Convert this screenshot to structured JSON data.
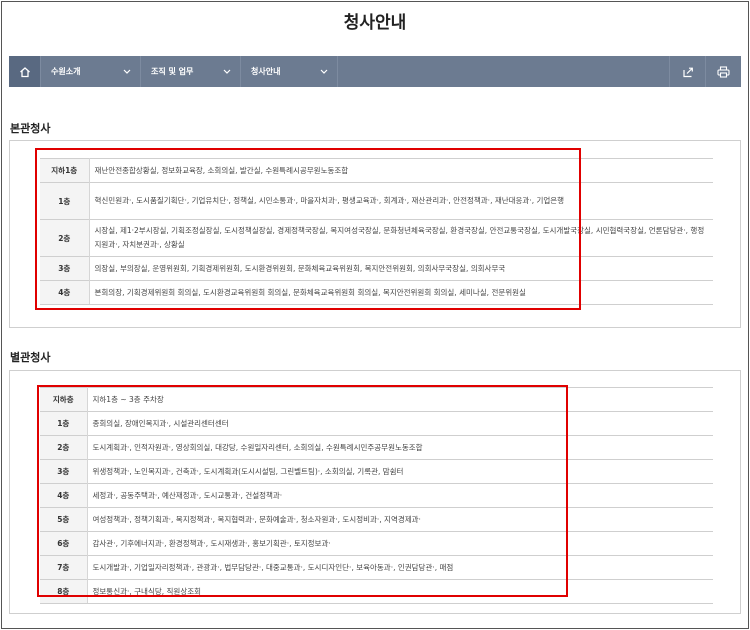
{
  "page": {
    "title": "청사안내"
  },
  "nav": {
    "items": [
      {
        "label": "수원소개"
      },
      {
        "label": "조직 및 업무"
      },
      {
        "label": "청사안내"
      }
    ],
    "home_icon": "home-icon",
    "share_icon": "share-icon",
    "print_icon": "print-icon"
  },
  "main_building": {
    "title": "본관청사",
    "rows": [
      {
        "floor": "지하1층",
        "text": "재난안전종합상황실, 정보화교육장, 소회의실, 발간실, 수원특례시공무원노동조합"
      },
      {
        "floor": "1층",
        "text": "혁신민원과·, 도시품질기획단·, 기업유치단·, 정책실, 시민소통과·, 마을자치과·, 평생교육과·, 회계과·, 재산관리과·, 안전정책과·, 재난대응과·, 기업은행"
      },
      {
        "floor": "2층",
        "text": "시장실, 제1·2부시장실, 기획조정실장실, 도시정책실장실, 경제정책국장실, 복지여성국장실, 문화청년체육국장실, 환경국장실, 안전교통국장실, 도시개발국장실, 시민협력국장실, 언론담당관·, 행정지원과·, 자치분권과·, 상황실"
      },
      {
        "floor": "3층",
        "text": "의장실, 부의장실, 운영위원회, 기획경제위원회, 도시환경위원회, 문화체육교육위원회, 복지안전위원회, 의회사무국장실, 의회사무국"
      },
      {
        "floor": "4층",
        "text": "본회의장, 기획경제위원회 회의실, 도시환경교육위원회 회의실, 문화체육교육위원회 회의실, 복지안전위원회 회의실, 세미나실, 전문위원실"
      }
    ]
  },
  "annex_building": {
    "title": "별관청사",
    "rows": [
      {
        "floor": "지하층",
        "text": "지하1층 ~ 3층 주차장"
      },
      {
        "floor": "1층",
        "text": "종회의실, 장애인복지과·, 시설관리센터센터"
      },
      {
        "floor": "2층",
        "text": "도시계획과·, 인적자원과·, 영상회의실, 대강당, 수원일자리센터, 소회의실, 수원특례시민주공무원노동조합"
      },
      {
        "floor": "3층",
        "text": "위생정책과·, 노인복지과·, 건축과·, 도시계획과(도시시설팀, 그린벨트팀)·, 소회의실, 기록관, 맘쉼터"
      },
      {
        "floor": "4층",
        "text": "세정과·, 공동주택과·, 예산재정과·, 도시교통과·, 건설정책과·"
      },
      {
        "floor": "5층",
        "text": "여성정책과·, 정책기획과·, 복지정책과·, 복지협력과·, 문화예술과·, 청소자원과·, 도시정비과·, 지역경제과·"
      },
      {
        "floor": "6층",
        "text": "감사관·, 기후에너지과·, 환경정책과·, 도시재생과·, 홍보기획관·, 토지정보과·"
      },
      {
        "floor": "7층",
        "text": "도시개발과·, 기업일자리정책과·, 관광과·, 법무담당관·, 대중교통과·, 도시디자인단·, 보육아동과·, 인권담당관·, 매점"
      },
      {
        "floor": "8층",
        "text": "정보통신과·, 구내식당, 직원상조회"
      }
    ]
  },
  "colors": {
    "nav_bg": "#6c7b91",
    "highlight": "#e00000"
  }
}
